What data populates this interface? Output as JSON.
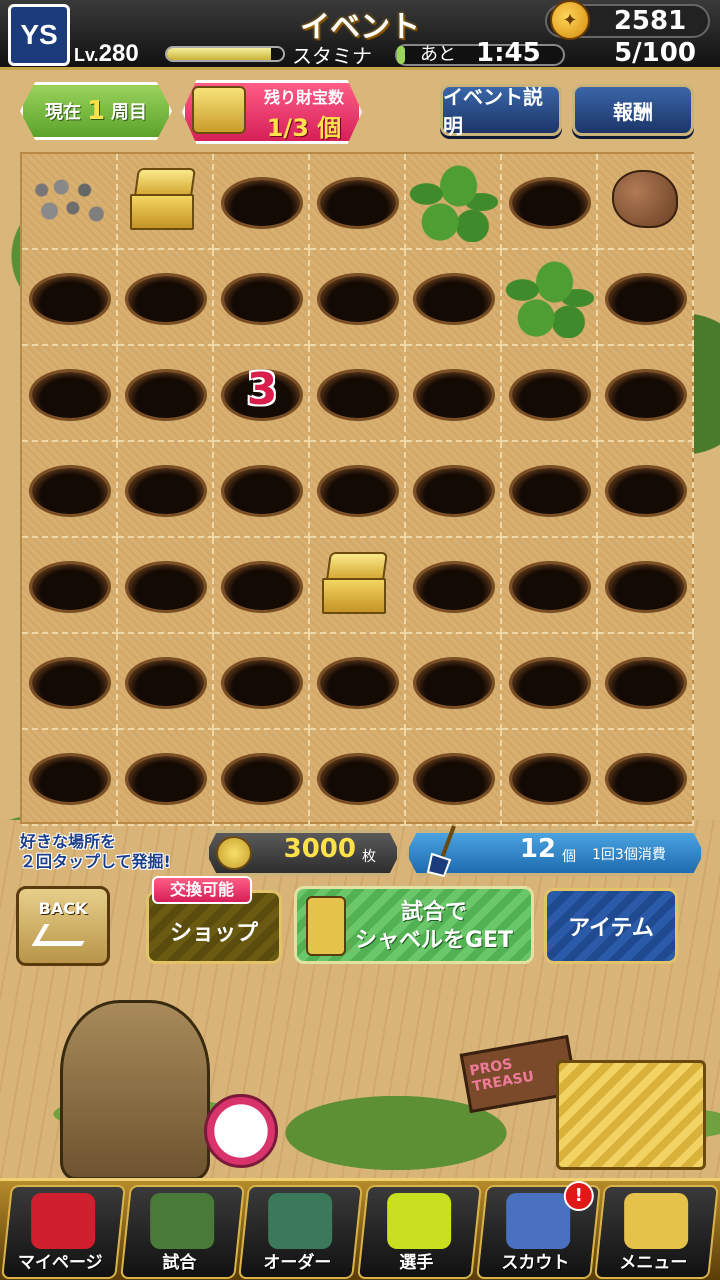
{
  "header": {
    "team_logo": "YS",
    "title": "イベント",
    "coins": "2581",
    "level_label": "Lv.",
    "level": "280",
    "level_progress": 0.9,
    "stamina_label": "スタミナ",
    "stamina_remaining_label": "あと",
    "stamina_time": "1:45",
    "stamina_count": "5/100",
    "stamina_progress": 0.05
  },
  "info": {
    "round_prefix": "現在",
    "round_number": "1",
    "round_suffix": "周目",
    "treasure_label": "残り財宝数",
    "treasure_count": "1/3 個",
    "event_help_button": "イベント説明",
    "reward_button": "報酬"
  },
  "board": {
    "columns": 7,
    "rows": 7,
    "cells": [
      [
        "rocks",
        "chest",
        "hole",
        "hole",
        "grass",
        "hole",
        "boulder"
      ],
      [
        "hole",
        "hole",
        "hole",
        "hole",
        "hole",
        "grass",
        "hole"
      ],
      [
        "hole",
        "hole",
        "number",
        "hole",
        "hole",
        "hole",
        "hole"
      ],
      [
        "hole",
        "hole",
        "hole",
        "hole",
        "hole",
        "hole",
        "hole"
      ],
      [
        "hole",
        "hole",
        "hole",
        "chest",
        "hole",
        "hole",
        "hole"
      ],
      [
        "hole",
        "hole",
        "hole",
        "hole",
        "hole",
        "hole",
        "hole"
      ],
      [
        "hole",
        "hole",
        "hole",
        "hole",
        "hole",
        "hole",
        "hole"
      ]
    ],
    "number_value": "3"
  },
  "status": {
    "hint": "好きな場所を\n２回タップして発掘!",
    "medal_count": "3000",
    "medal_unit": "枚",
    "shovel_count": "12",
    "shovel_unit": "個",
    "shovel_note": "1回3個消費"
  },
  "actions": {
    "back": "BACK",
    "shop_badge": "交換可能",
    "shop": "ショップ",
    "match": "試合で\nシャベルをGET",
    "item": "アイテム"
  },
  "decor": {
    "sign_text": "PROS\nTREASU"
  },
  "nav": [
    {
      "label": "マイページ",
      "icon": "mypage-icon",
      "color": "#d02030"
    },
    {
      "label": "試合",
      "icon": "stadium-icon",
      "color": "#4a7a3a"
    },
    {
      "label": "オーダー",
      "icon": "order-icon",
      "color": "#3a7a5a"
    },
    {
      "label": "選手",
      "icon": "player-icon",
      "color": "#c8e020"
    },
    {
      "label": "スカウト",
      "icon": "scout-icon",
      "color": "#4a70c0",
      "badge": "!"
    },
    {
      "label": "メニュー",
      "icon": "menu-icon",
      "color": "#e5c24a"
    }
  ]
}
